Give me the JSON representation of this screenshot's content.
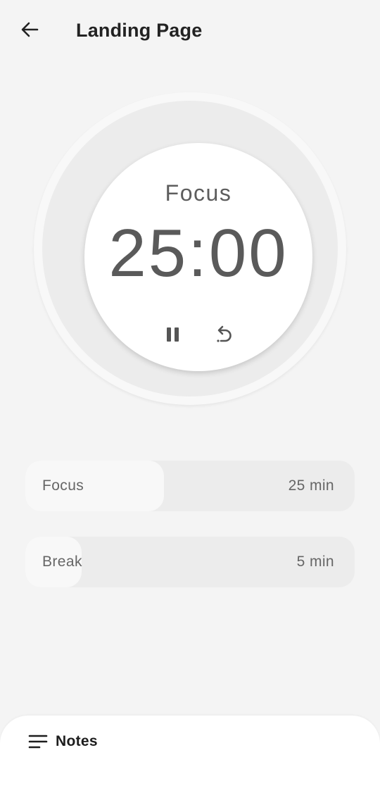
{
  "header": {
    "title": "Landing Page",
    "back_icon": "arrow-left-icon"
  },
  "timer": {
    "mode_label": "Focus",
    "time": "25:00",
    "pause_icon": "pause-icon",
    "reset_icon": "reset-icon"
  },
  "durations": [
    {
      "label": "Focus",
      "value": "25 min",
      "fill_fraction": 0.42
    },
    {
      "label": "Break",
      "value": "5 min",
      "fill_fraction": 0.17
    }
  ],
  "notes_sheet": {
    "label": "Notes",
    "icon": "notes-lines-icon"
  },
  "colors": {
    "background": "#f4f4f4",
    "track": "#ececec",
    "fill": "#f8f8f8",
    "surface": "#ffffff",
    "text_primary": "#1d1d1d",
    "text_secondary": "#666666"
  }
}
